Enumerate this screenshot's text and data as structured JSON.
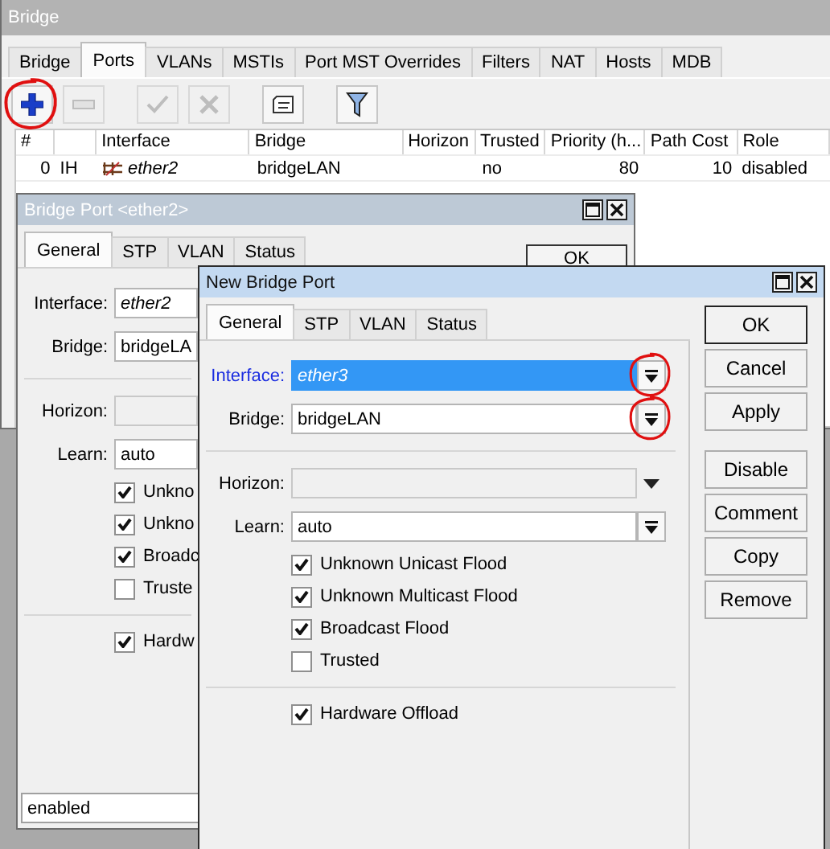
{
  "main_window": {
    "title": "Bridge",
    "tabs": [
      {
        "label": "Bridge",
        "selected": false
      },
      {
        "label": "Ports",
        "selected": true
      },
      {
        "label": "VLANs",
        "selected": false
      },
      {
        "label": "MSTIs",
        "selected": false
      },
      {
        "label": "Port MST Overrides",
        "selected": false
      },
      {
        "label": "Filters",
        "selected": false
      },
      {
        "label": "NAT",
        "selected": false
      },
      {
        "label": "Hosts",
        "selected": false
      },
      {
        "label": "MDB",
        "selected": false
      }
    ],
    "toolbar": [
      {
        "kind": "add",
        "disabled": false,
        "circled": true
      },
      {
        "kind": "remove",
        "disabled": true,
        "circled": false
      },
      {
        "kind": "enable",
        "disabled": true,
        "circled": false
      },
      {
        "kind": "disable",
        "disabled": true,
        "circled": false
      },
      {
        "kind": "comment",
        "disabled": false,
        "circled": false
      },
      {
        "kind": "filter",
        "disabled": false,
        "circled": false
      }
    ],
    "table": {
      "columns": [
        {
          "label": "#"
        },
        {},
        {
          "label": "Interface"
        },
        {
          "label": "Bridge"
        },
        {
          "label": "Horizon"
        },
        {
          "label": "Trusted"
        },
        {
          "label": "Priority (h..."
        },
        {
          "label": "Path Cost"
        },
        {
          "label": "Role"
        }
      ],
      "rows": [
        {
          "cells": [
            {
              "text": "0"
            },
            {
              "text": "IH"
            },
            {
              "text": "ether2",
              "kind": "interface"
            },
            {
              "text": "bridgeLAN"
            },
            {},
            {
              "text": "no"
            },
            {
              "text": "80"
            },
            {
              "text": "10"
            },
            {
              "text": "disabled"
            }
          ]
        }
      ]
    }
  },
  "back_window": {
    "title": "Bridge Port <ether2>",
    "active": false,
    "tabs": [
      {
        "label": "General",
        "selected": true
      },
      {
        "label": "STP",
        "selected": false
      },
      {
        "label": "VLAN",
        "selected": false
      },
      {
        "label": "Status",
        "selected": false
      }
    ],
    "buttons": [
      {
        "label": "OK"
      }
    ],
    "fields": [
      {
        "kind": "select",
        "label": "Interface:",
        "value": "ether2",
        "italic": true,
        "focused": false,
        "disabled": false
      },
      {
        "kind": "select",
        "label": "Bridge:",
        "value": "bridgeLA",
        "italic": false,
        "focused": false,
        "disabled": false
      },
      {
        "kind": "separator"
      },
      {
        "kind": "select",
        "label": "Horizon:",
        "italic": false,
        "focused": false,
        "disabled": true
      },
      {
        "kind": "select",
        "label": "Learn:",
        "value": "auto",
        "italic": false,
        "focused": false,
        "disabled": false
      }
    ],
    "checkboxes": [
      {
        "kind": "checkbox",
        "label": "Unkno",
        "checked": true
      },
      {
        "kind": "checkbox",
        "label": "Unkno",
        "checked": true
      },
      {
        "kind": "checkbox",
        "label": "Broadc",
        "checked": true
      },
      {
        "kind": "checkbox",
        "label": "Truste",
        "checked": false
      },
      {
        "kind": "separator"
      },
      {
        "kind": "checkbox",
        "label": "Hardw",
        "checked": true
      }
    ],
    "status": "enabled"
  },
  "front_window": {
    "title": "New Bridge Port",
    "active": true,
    "tabs": [
      {
        "label": "General",
        "selected": true
      },
      {
        "label": "STP",
        "selected": false
      },
      {
        "label": "VLAN",
        "selected": false
      },
      {
        "label": "Status",
        "selected": false
      }
    ],
    "buttons": [
      {
        "label": "OK",
        "default": true
      },
      {
        "label": "Cancel",
        "default": false
      },
      {
        "label": "Apply",
        "default": false
      },
      {
        "kind": "gap"
      },
      {
        "label": "Disable",
        "default": false
      },
      {
        "label": "Comment",
        "default": false
      },
      {
        "label": "Copy",
        "default": false
      },
      {
        "label": "Remove",
        "default": false
      }
    ],
    "fields": [
      {
        "kind": "select",
        "label": "Interface:",
        "value": "ether3",
        "italic": true,
        "focused": true,
        "disabled": false,
        "circled": true
      },
      {
        "kind": "select",
        "label": "Bridge:",
        "value": "bridgeLAN",
        "italic": false,
        "focused": false,
        "disabled": false,
        "circled": true
      },
      {
        "kind": "separator"
      },
      {
        "kind": "select",
        "label": "Horizon:",
        "italic": false,
        "focused": false,
        "disabled": true,
        "circled": false
      },
      {
        "kind": "select",
        "label": "Learn:",
        "value": "auto",
        "italic": false,
        "focused": false,
        "disabled": false,
        "circled": false
      }
    ],
    "checkboxes": [
      {
        "kind": "checkbox",
        "label": "Unknown Unicast Flood",
        "checked": true
      },
      {
        "kind": "checkbox",
        "label": "Unknown Multicast Flood",
        "checked": true
      },
      {
        "kind": "checkbox",
        "label": "Broadcast Flood",
        "checked": true
      },
      {
        "kind": "checkbox",
        "label": "Trusted",
        "checked": false
      },
      {
        "kind": "separator"
      },
      {
        "kind": "checkbox",
        "label": "Hardware Offload",
        "checked": true
      }
    ]
  }
}
